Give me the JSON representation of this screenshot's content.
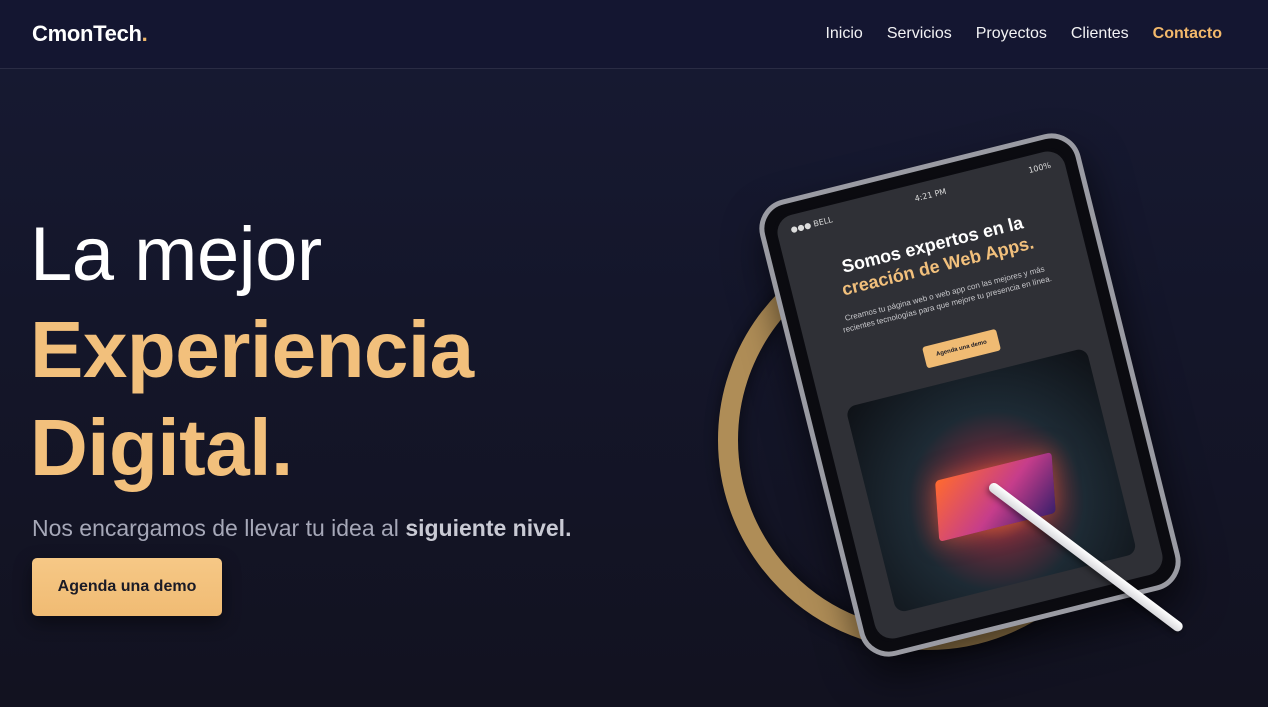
{
  "brand": {
    "name": "CmonTech",
    "dot": "."
  },
  "nav": {
    "items": [
      {
        "label": "Inicio"
      },
      {
        "label": "Servicios"
      },
      {
        "label": "Proyectos"
      },
      {
        "label": "Clientes"
      },
      {
        "label": "Contacto",
        "active": true
      }
    ]
  },
  "hero": {
    "line1": "La mejor",
    "line2": "Experiencia",
    "line3": "Digital.",
    "subtitle_prefix": "Nos encargamos de llevar tu idea al ",
    "subtitle_strong": "siguiente nivel.",
    "cta_label": "Agenda una demo"
  },
  "tablet_screen": {
    "carrier": "●●● BELL",
    "time": "4:21 PM",
    "battery": "100%",
    "title_line1": "Somos expertos en la",
    "title_line2_accent": "creación de Web Apps.",
    "description": "Creamos tu página web o web app con las mejores y más recientes tecnologías para que mejore tu presencia en línea.",
    "button_label": "Agenda una demo"
  },
  "colors": {
    "background": "#14162a",
    "accent": "#f2c07c",
    "nav_active": "#f2b86b",
    "ring": "#b8945a"
  }
}
